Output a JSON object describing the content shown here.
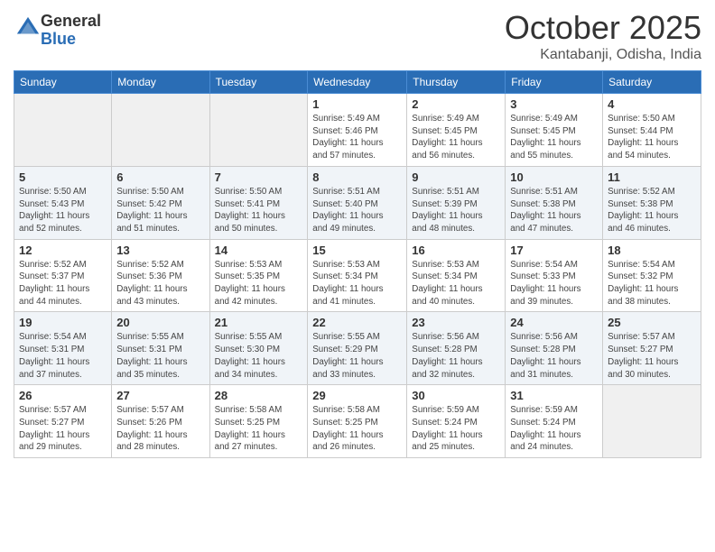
{
  "header": {
    "logo_general": "General",
    "logo_blue": "Blue",
    "month_title": "October 2025",
    "location": "Kantabanji, Odisha, India"
  },
  "weekdays": [
    "Sunday",
    "Monday",
    "Tuesday",
    "Wednesday",
    "Thursday",
    "Friday",
    "Saturday"
  ],
  "weeks": [
    [
      {
        "day": "",
        "info": ""
      },
      {
        "day": "",
        "info": ""
      },
      {
        "day": "",
        "info": ""
      },
      {
        "day": "1",
        "info": "Sunrise: 5:49 AM\nSunset: 5:46 PM\nDaylight: 11 hours\nand 57 minutes."
      },
      {
        "day": "2",
        "info": "Sunrise: 5:49 AM\nSunset: 5:45 PM\nDaylight: 11 hours\nand 56 minutes."
      },
      {
        "day": "3",
        "info": "Sunrise: 5:49 AM\nSunset: 5:45 PM\nDaylight: 11 hours\nand 55 minutes."
      },
      {
        "day": "4",
        "info": "Sunrise: 5:50 AM\nSunset: 5:44 PM\nDaylight: 11 hours\nand 54 minutes."
      }
    ],
    [
      {
        "day": "5",
        "info": "Sunrise: 5:50 AM\nSunset: 5:43 PM\nDaylight: 11 hours\nand 52 minutes."
      },
      {
        "day": "6",
        "info": "Sunrise: 5:50 AM\nSunset: 5:42 PM\nDaylight: 11 hours\nand 51 minutes."
      },
      {
        "day": "7",
        "info": "Sunrise: 5:50 AM\nSunset: 5:41 PM\nDaylight: 11 hours\nand 50 minutes."
      },
      {
        "day": "8",
        "info": "Sunrise: 5:51 AM\nSunset: 5:40 PM\nDaylight: 11 hours\nand 49 minutes."
      },
      {
        "day": "9",
        "info": "Sunrise: 5:51 AM\nSunset: 5:39 PM\nDaylight: 11 hours\nand 48 minutes."
      },
      {
        "day": "10",
        "info": "Sunrise: 5:51 AM\nSunset: 5:38 PM\nDaylight: 11 hours\nand 47 minutes."
      },
      {
        "day": "11",
        "info": "Sunrise: 5:52 AM\nSunset: 5:38 PM\nDaylight: 11 hours\nand 46 minutes."
      }
    ],
    [
      {
        "day": "12",
        "info": "Sunrise: 5:52 AM\nSunset: 5:37 PM\nDaylight: 11 hours\nand 44 minutes."
      },
      {
        "day": "13",
        "info": "Sunrise: 5:52 AM\nSunset: 5:36 PM\nDaylight: 11 hours\nand 43 minutes."
      },
      {
        "day": "14",
        "info": "Sunrise: 5:53 AM\nSunset: 5:35 PM\nDaylight: 11 hours\nand 42 minutes."
      },
      {
        "day": "15",
        "info": "Sunrise: 5:53 AM\nSunset: 5:34 PM\nDaylight: 11 hours\nand 41 minutes."
      },
      {
        "day": "16",
        "info": "Sunrise: 5:53 AM\nSunset: 5:34 PM\nDaylight: 11 hours\nand 40 minutes."
      },
      {
        "day": "17",
        "info": "Sunrise: 5:54 AM\nSunset: 5:33 PM\nDaylight: 11 hours\nand 39 minutes."
      },
      {
        "day": "18",
        "info": "Sunrise: 5:54 AM\nSunset: 5:32 PM\nDaylight: 11 hours\nand 38 minutes."
      }
    ],
    [
      {
        "day": "19",
        "info": "Sunrise: 5:54 AM\nSunset: 5:31 PM\nDaylight: 11 hours\nand 37 minutes."
      },
      {
        "day": "20",
        "info": "Sunrise: 5:55 AM\nSunset: 5:31 PM\nDaylight: 11 hours\nand 35 minutes."
      },
      {
        "day": "21",
        "info": "Sunrise: 5:55 AM\nSunset: 5:30 PM\nDaylight: 11 hours\nand 34 minutes."
      },
      {
        "day": "22",
        "info": "Sunrise: 5:55 AM\nSunset: 5:29 PM\nDaylight: 11 hours\nand 33 minutes."
      },
      {
        "day": "23",
        "info": "Sunrise: 5:56 AM\nSunset: 5:28 PM\nDaylight: 11 hours\nand 32 minutes."
      },
      {
        "day": "24",
        "info": "Sunrise: 5:56 AM\nSunset: 5:28 PM\nDaylight: 11 hours\nand 31 minutes."
      },
      {
        "day": "25",
        "info": "Sunrise: 5:57 AM\nSunset: 5:27 PM\nDaylight: 11 hours\nand 30 minutes."
      }
    ],
    [
      {
        "day": "26",
        "info": "Sunrise: 5:57 AM\nSunset: 5:27 PM\nDaylight: 11 hours\nand 29 minutes."
      },
      {
        "day": "27",
        "info": "Sunrise: 5:57 AM\nSunset: 5:26 PM\nDaylight: 11 hours\nand 28 minutes."
      },
      {
        "day": "28",
        "info": "Sunrise: 5:58 AM\nSunset: 5:25 PM\nDaylight: 11 hours\nand 27 minutes."
      },
      {
        "day": "29",
        "info": "Sunrise: 5:58 AM\nSunset: 5:25 PM\nDaylight: 11 hours\nand 26 minutes."
      },
      {
        "day": "30",
        "info": "Sunrise: 5:59 AM\nSunset: 5:24 PM\nDaylight: 11 hours\nand 25 minutes."
      },
      {
        "day": "31",
        "info": "Sunrise: 5:59 AM\nSunset: 5:24 PM\nDaylight: 11 hours\nand 24 minutes."
      },
      {
        "day": "",
        "info": ""
      }
    ]
  ]
}
